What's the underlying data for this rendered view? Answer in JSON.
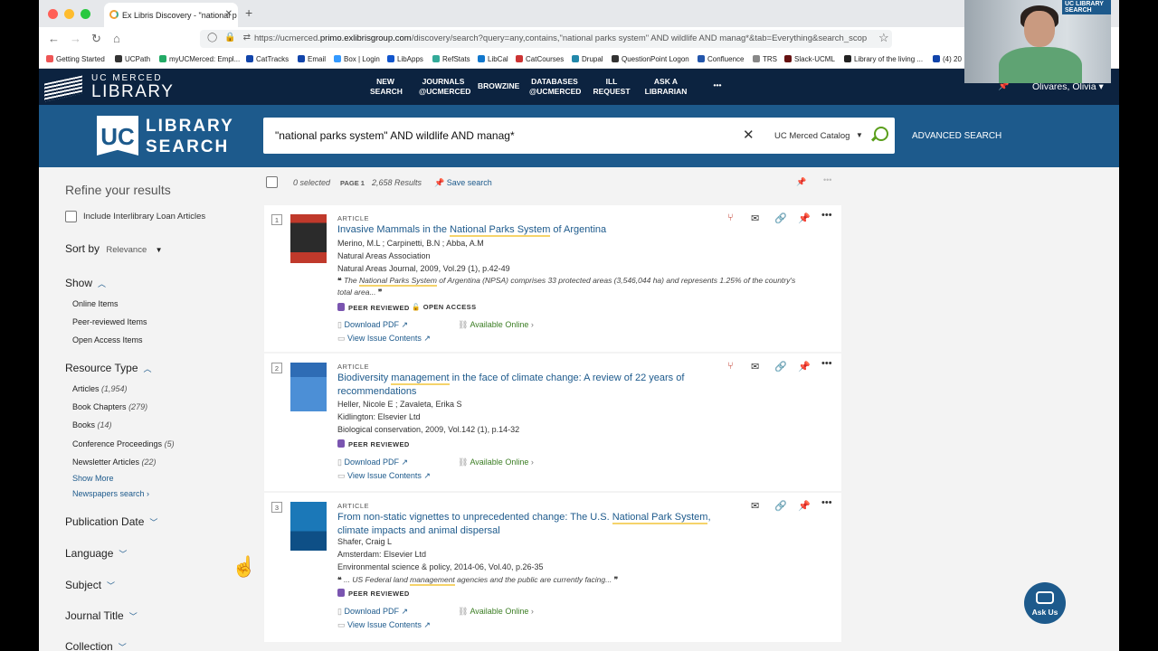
{
  "browser": {
    "tab_title": "Ex Libris Discovery - \"national p",
    "url_prefix": "https://ucmerced.",
    "url_host": "primo.exlibrisgroup.com",
    "url_rest": "/discovery/search?query=any,contains,\"national parks system\" AND wildlife AND manag*&tab=Everything&search_scop",
    "bookmarks": [
      "Getting Started",
      "UCPath",
      "myUCMerced: Empl...",
      "CatTracks",
      "Email",
      "Box | Login",
      "LibApps",
      "RefStats",
      "LibCal",
      "CatCourses",
      "Drupal",
      "QuestionPoint Logon",
      "Confluence",
      "TRS",
      "Slack-UCML",
      "Library of the living ...",
      "(4) 20"
    ]
  },
  "site": {
    "logo_top": "UC MERCED",
    "logo_bottom": "LIBRARY",
    "menu": [
      "NEW\nSEARCH",
      "JOURNALS\n@UCMERCED",
      "BROWZINE",
      "DATABASES\n@UCMERCED",
      "ILL\nREQUEST",
      "ASK A\nLIBRARIAN",
      "•••"
    ],
    "user": "Olivares, Olivia"
  },
  "search": {
    "uc": "UC",
    "brand1": "LIBRARY",
    "brand2": "SEARCH",
    "query": "\"national parks system\" AND wildlife AND manag*",
    "scope": "UC Merced Catalog",
    "advanced": "ADVANCED SEARCH"
  },
  "facets": {
    "refine": "Refine your results",
    "ill": "Include Interlibrary Loan Articles",
    "sort_label": "Sort by",
    "sort_value": "Relevance",
    "show_title": "Show",
    "show_items": [
      "Online Items",
      "Peer-reviewed Items",
      "Open Access Items"
    ],
    "rtype_title": "Resource Type",
    "rtype_items": [
      {
        "label": "Articles",
        "count": "(1,954)"
      },
      {
        "label": "Book Chapters",
        "count": "(279)"
      },
      {
        "label": "Books",
        "count": "(14)"
      },
      {
        "label": "Conference Proceedings",
        "count": "(5)"
      },
      {
        "label": "Newsletter Articles",
        "count": "(22)"
      }
    ],
    "show_more": "Show More",
    "newspapers": "Newspapers search",
    "collapsed": [
      "Publication Date",
      "Language",
      "Subject",
      "Journal Title",
      "Collection"
    ]
  },
  "results_bar": {
    "selected": "0 selected",
    "page": "PAGE 1",
    "count": "2,658 Results",
    "save": "Save search"
  },
  "results": [
    {
      "num": "1",
      "type": "ARTICLE",
      "title_pre": "Invasive Mammals in the ",
      "title_hl": "National Parks System",
      "title_post": " of Argentina",
      "authors": "Merino, M.L ; Carpinetti, B.N ; Abba, A.M",
      "publisher": "Natural Areas Association",
      "source": "Natural Areas Journal, 2009, Vol.29 (1), p.42-49",
      "snippet_pre": "The ",
      "snippet_hl": "National Parks System",
      "snippet_post": " of Argentina (NPSA) comprises 33 protected areas (3,546,044 ha) and represents 1.25% of the country's total area...",
      "peer": "PEER REVIEWED",
      "oa": "OPEN ACCESS",
      "download": "Download PDF",
      "avail": "Available Online",
      "issue": "View Issue Contents"
    },
    {
      "num": "2",
      "type": "ARTICLE",
      "title_pre": "Biodiversity ",
      "title_hl": "management",
      "title_post": " in the face of climate change: A review of 22 years of recommendations",
      "authors": "Heller, Nicole E ; Zavaleta, Erika S",
      "publisher": "Kidlington: Elsevier Ltd",
      "source": "Biological conservation, 2009, Vol.142 (1), p.14-32",
      "peer": "PEER REVIEWED",
      "download": "Download PDF",
      "avail": "Available Online",
      "issue": "View Issue Contents"
    },
    {
      "num": "3",
      "type": "ARTICLE",
      "title_pre": "From non-static vignettes to unprecedented change: The U.S. ",
      "title_hl": "National Park System",
      "title_post": ", climate impacts and animal dispersal",
      "authors": "Shafer, Craig L",
      "publisher": "Amsterdam: Elsevier Ltd",
      "source": "Environmental science & policy, 2014-06, Vol.40, p.26-35",
      "snippet_pre": "... US Federal land ",
      "snippet_hl": "management",
      "snippet_post": " agencies and the public are currently facing...",
      "peer": "PEER REVIEWED",
      "download": "Download PDF",
      "avail": "Available Online",
      "issue": "View Issue Contents"
    }
  ],
  "ask": "Ask Us",
  "cam_brand": "UC LIBRARY SEARCH",
  "colors": {
    "navy": "#0c2340",
    "blue": "#1d5a8c",
    "green": "#3b7d23",
    "highlight": "#f5d36a"
  }
}
